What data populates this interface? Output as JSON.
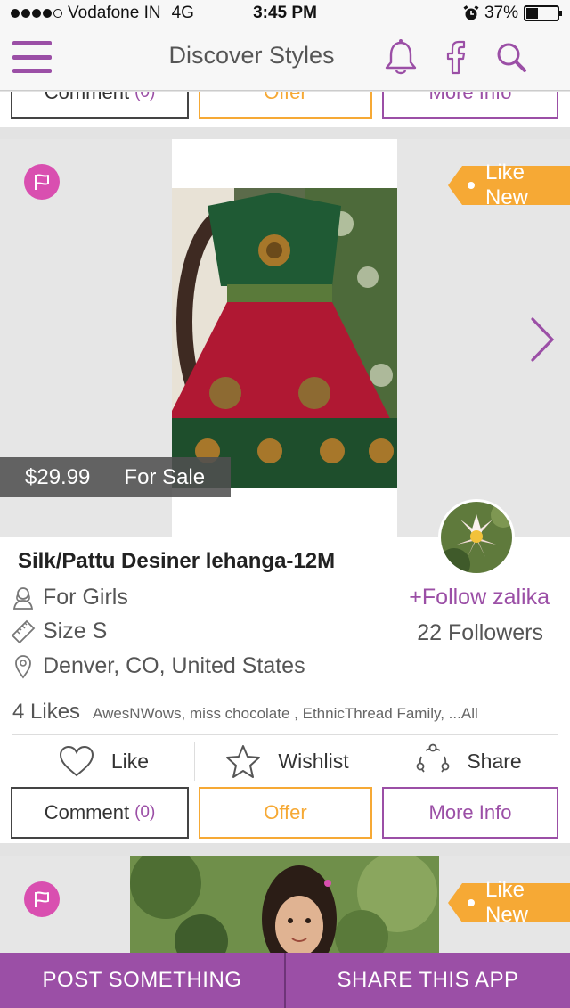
{
  "status_bar": {
    "carrier": "Vodafone IN",
    "network": "4G",
    "time": "3:45 PM",
    "battery": "37%",
    "battery_level": 0.37
  },
  "header": {
    "title": "Discover Styles",
    "icons": [
      "menu-icon",
      "bell-icon",
      "facebook-icon",
      "search-icon"
    ]
  },
  "previous_card": {
    "comment_label": "Comment",
    "comment_count": "(0)",
    "offer_label": "Offer",
    "more_info_label": "More Info"
  },
  "listing": {
    "condition": "Like New",
    "price": "$29.99",
    "sale_status": "For Sale",
    "title": "Silk/Pattu Desiner lehanga-12M",
    "category": "For Girls",
    "size": "Size S",
    "location": "Denver, CO, United States",
    "follow_label": "+Follow zalika",
    "followers": "22 Followers",
    "likes": "4 Likes",
    "likers": "AwesNWows, miss chocolate , EthnicThread Family, ...All",
    "actions": {
      "like": "Like",
      "wishlist": "Wishlist",
      "share": "Share"
    },
    "comment_label": "Comment",
    "comment_count": "(0)",
    "offer_label": "Offer",
    "more_info_label": "More Info"
  },
  "next_listing": {
    "condition": "Like New"
  },
  "bottom_bar": {
    "post": "POST SOMETHING",
    "share": "SHARE THIS APP"
  },
  "colors": {
    "accent_purple": "#9b4fa6",
    "orange": "#f6a935",
    "flag_pink": "#d94fb0"
  }
}
